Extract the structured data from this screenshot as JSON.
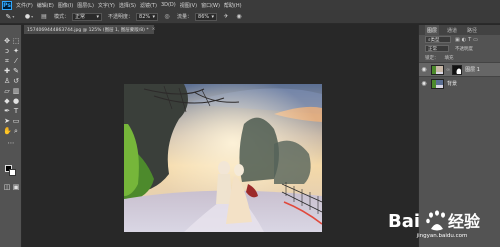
{
  "menubar": {
    "logo": "Ps",
    "items": [
      "文件(F)",
      "编辑(E)",
      "图像(I)",
      "图层(L)",
      "文字(Y)",
      "选择(S)",
      "滤镜(T)",
      "3D(D)",
      "视图(V)",
      "窗口(W)",
      "帮助(H)"
    ]
  },
  "options": {
    "mode_label": "模式：",
    "mode_value": "正常",
    "opacity_label": "不透明度：",
    "opacity_value": "82%",
    "flow_label": "流量：",
    "flow_value": "86%"
  },
  "document": {
    "tab_title": "1574069444863744.jpg @ 125% (图层 1, 图层蒙版/8) *",
    "close_glyph": "×"
  },
  "layers_panel": {
    "tabs": [
      "图层",
      "通道",
      "路径"
    ],
    "kind_label": "类型",
    "blend_mode": "正常",
    "opacity_label": "不透明度",
    "lock_label": "锁定：",
    "fill_label": "填充",
    "layers": [
      {
        "name": "图层 1",
        "selected": true,
        "has_mask": true
      },
      {
        "name": "背景",
        "selected": false,
        "has_mask": false
      }
    ]
  },
  "watermark": {
    "logo_text": "Bai 经验",
    "url": "jingyan.baidu.com"
  },
  "colors": {
    "foreground": "#000000",
    "background": "#ffffff",
    "chrome": "#535353"
  }
}
